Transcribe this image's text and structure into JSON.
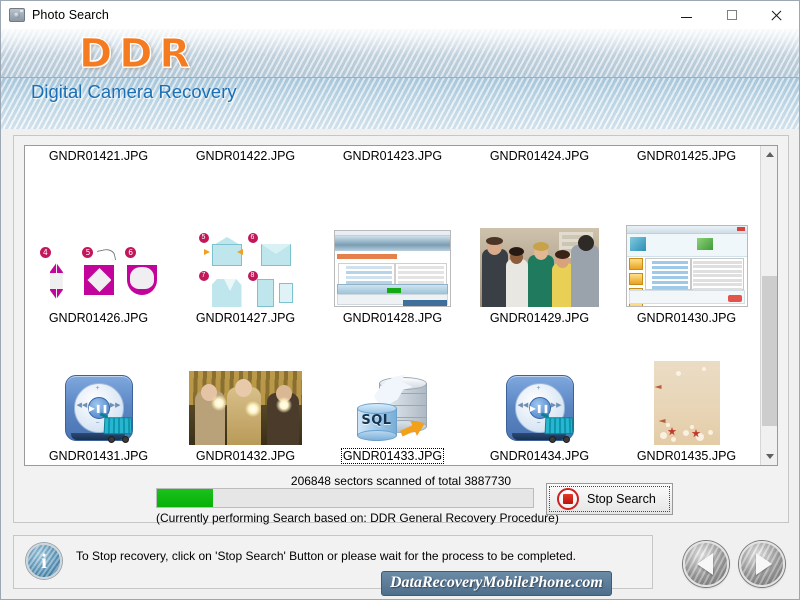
{
  "window": {
    "title": "Photo Search",
    "icon": "camera-icon",
    "minimize_label": "—",
    "maximize_label": "□",
    "close_label": "✕"
  },
  "banner": {
    "logo": "DDR",
    "subtitle": "Digital Camera Recovery",
    "logo_color": "#f57b20",
    "subtitle_color": "#1b6fb5"
  },
  "file_grid": {
    "rows": [
      {
        "cells": [
          {
            "label": "GNDR01421.JPG",
            "selected": false
          },
          {
            "label": "GNDR01422.JPG",
            "selected": false
          },
          {
            "label": "GNDR01423.JPG",
            "selected": false
          },
          {
            "label": "GNDR01424.JPG",
            "selected": false
          },
          {
            "label": "GNDR01425.JPG",
            "selected": false
          }
        ]
      },
      {
        "cells": [
          {
            "label": "GNDR01426.JPG",
            "selected": false
          },
          {
            "label": "GNDR01427.JPG",
            "selected": false
          },
          {
            "label": "GNDR01428.JPG",
            "selected": false
          },
          {
            "label": "GNDR01429.JPG",
            "selected": false
          },
          {
            "label": "GNDR01430.JPG",
            "selected": false
          }
        ]
      },
      {
        "cells": [
          {
            "label": "GNDR01431.JPG",
            "selected": false
          },
          {
            "label": "GNDR01432.JPG",
            "selected": false
          },
          {
            "label": "GNDR01433.JPG",
            "selected": true
          },
          {
            "label": "GNDR01434.JPG",
            "selected": false
          },
          {
            "label": "GNDR01435.JPG",
            "selected": false
          }
        ]
      }
    ],
    "scrollbar": {
      "up_icon": "chevron-up-icon",
      "down_icon": "chevron-down-icon"
    }
  },
  "progress": {
    "sectors_text": "206848  sectors scanned of total 3887730",
    "sectors_scanned": 206848,
    "sectors_total": 3887730,
    "percent": 15,
    "fill_color": "#0ab00a",
    "based_on_text": "(Currently performing Search based on:  DDR General Recovery Procedure)"
  },
  "stop_button": {
    "label": "Stop Search",
    "icon": "stop-square-icon",
    "icon_color": "#cf2020"
  },
  "footer": {
    "info_icon": "info-icon",
    "info_glyph": "i",
    "message": "To Stop recovery, click on 'Stop Search' Button or please wait for the process to be completed.",
    "watermark": "DataRecoveryMobilePhone.com",
    "nav_back_icon": "arrow-left-icon",
    "nav_next_icon": "arrow-right-icon"
  }
}
